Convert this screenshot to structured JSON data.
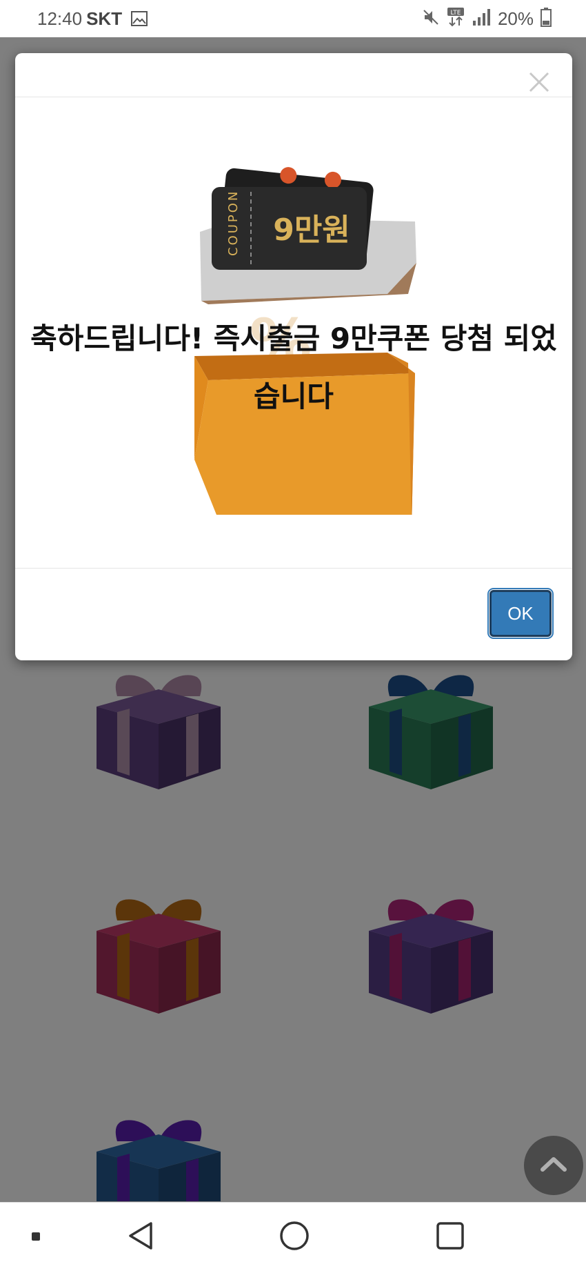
{
  "status_bar": {
    "time": "12:40",
    "carrier": "SKT",
    "battery": "20%"
  },
  "modal": {
    "message": "축하드립니다! 즉시출금 9만쿠폰 당첨 되었습니다",
    "ok_label": "OK",
    "coupon_label": "COUPON",
    "coupon_amount": "9만원"
  },
  "colors": {
    "ok_button": "#337ab7",
    "overlay": "rgba(0,0,0,0.5)",
    "box_orange": "#e89a2a",
    "coupon_dark": "#2a2a2a",
    "coupon_gold": "#d9b25a"
  },
  "icons": [
    "image-icon",
    "mute-icon",
    "lte-icon",
    "signal-icon",
    "battery-icon",
    "close-icon",
    "chevron-up-icon",
    "back-icon",
    "home-icon",
    "recents-icon"
  ]
}
